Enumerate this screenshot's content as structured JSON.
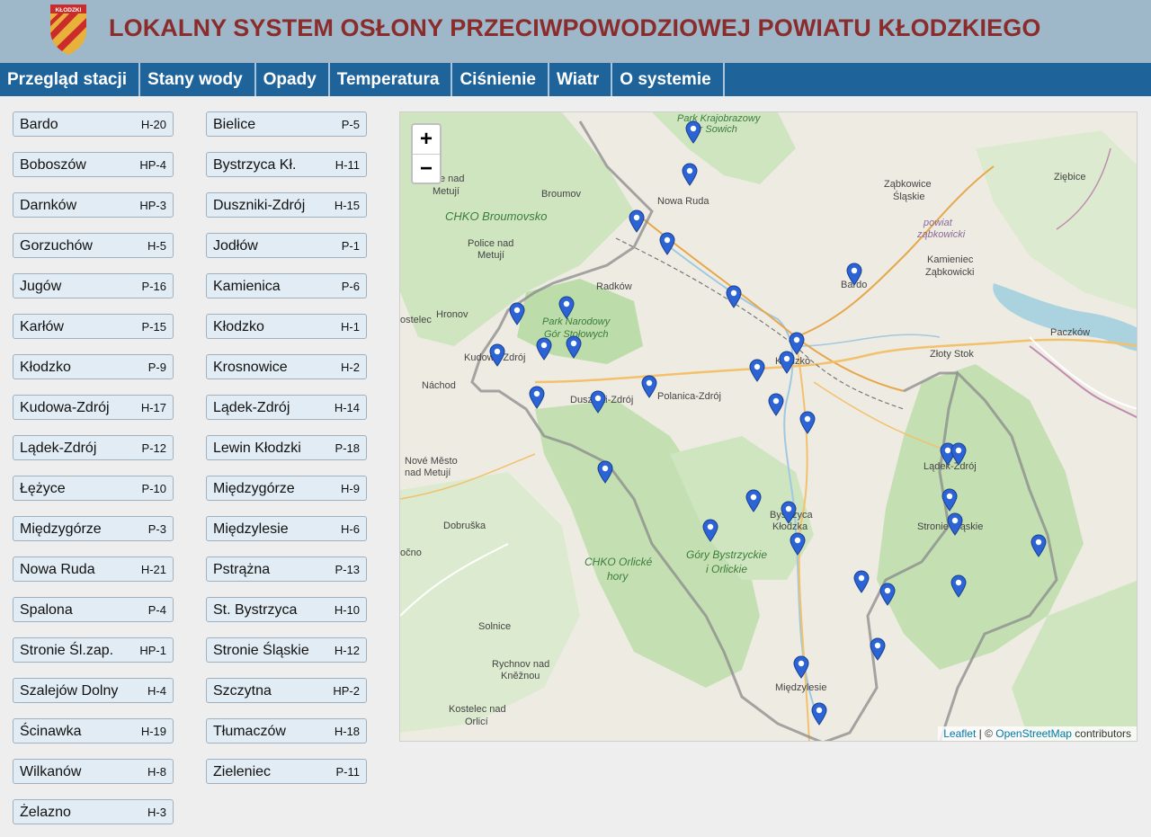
{
  "header": {
    "title": "LOKALNY SYSTEM OSŁONY PRZECIWPOWODZIOWEJ POWIATU KŁODZKIEGO",
    "logo_text": "KŁODZKI"
  },
  "nav": [
    "Przegląd stacji",
    "Stany wody",
    "Opady",
    "Temperatura",
    "Ciśnienie",
    "Wiatr",
    "O systemie"
  ],
  "stations_left": [
    {
      "name": "Bardo",
      "code": "H-20"
    },
    {
      "name": "Boboszów",
      "code": "HP-4"
    },
    {
      "name": "Darnków",
      "code": "HP-3"
    },
    {
      "name": "Gorzuchów",
      "code": "H-5"
    },
    {
      "name": "Jugów",
      "code": "P-16"
    },
    {
      "name": "Karłów",
      "code": "P-15"
    },
    {
      "name": "Kłodzko",
      "code": "P-9"
    },
    {
      "name": "Kudowa-Zdrój",
      "code": "H-17"
    },
    {
      "name": "Lądek-Zdrój",
      "code": "P-12"
    },
    {
      "name": "Łężyce",
      "code": "P-10"
    },
    {
      "name": "Międzygórze",
      "code": "P-3"
    },
    {
      "name": "Nowa Ruda",
      "code": "H-21"
    },
    {
      "name": "Spalona",
      "code": "P-4"
    },
    {
      "name": "Stronie Śl.zap.",
      "code": "HP-1"
    },
    {
      "name": "Szalejów Dolny",
      "code": "H-4"
    },
    {
      "name": "Ścinawka",
      "code": "H-19"
    },
    {
      "name": "Wilkanów",
      "code": "H-8"
    },
    {
      "name": "Żelazno",
      "code": "H-3"
    }
  ],
  "stations_right": [
    {
      "name": "Bielice",
      "code": "P-5"
    },
    {
      "name": "Bystrzyca Kł.",
      "code": "H-11"
    },
    {
      "name": "Duszniki-Zdrój",
      "code": "H-15"
    },
    {
      "name": "Jodłów",
      "code": "P-1"
    },
    {
      "name": "Kamienica",
      "code": "P-6"
    },
    {
      "name": "Kłodzko",
      "code": "H-1"
    },
    {
      "name": "Krosnowice",
      "code": "H-2"
    },
    {
      "name": "Lądek-Zdrój",
      "code": "H-14"
    },
    {
      "name": "Lewin Kłodzki",
      "code": "P-18"
    },
    {
      "name": "Międzygórze",
      "code": "H-9"
    },
    {
      "name": "Międzylesie",
      "code": "H-6"
    },
    {
      "name": "Pstrążna",
      "code": "P-13"
    },
    {
      "name": "St. Bystrzyca",
      "code": "H-10"
    },
    {
      "name": "Stronie Śląskie",
      "code": "H-12"
    },
    {
      "name": "Szczytna",
      "code": "HP-2"
    },
    {
      "name": "Tłumaczów",
      "code": "H-18"
    },
    {
      "name": "Zieleniec",
      "code": "P-11"
    }
  ],
  "map": {
    "zoom_in": "+",
    "zoom_out": "−",
    "attribution_leaflet": "Leaflet",
    "attribution_sep": " | © ",
    "attribution_osm": "OpenStreetMap",
    "attribution_tail": " contributors",
    "labels": {
      "park_sowie_1": "Park Krajobrazowy",
      "park_sowie_2": "Gór Sowich",
      "metuji_1": "ice nad",
      "metuji_2": "Metují",
      "broumov": "Broumov",
      "nowa_ruda": "Nowa Ruda",
      "chko_broumovsko": "CHKO Broumovsko",
      "police_1": "Police nad",
      "police_2": "Metují",
      "radkow": "Radków",
      "zabkowice_1": "Ząbkowice",
      "zabkowice_2": "Śląskie",
      "powiat_1": "powiat",
      "powiat_2": "ząbkowicki",
      "ziebice": "Ziębice",
      "kamieniec_1": "Kamieniec",
      "kamieniec_2": "Ząbkowicki",
      "bardo": "Bardo",
      "paczkow": "Paczków",
      "hronov": "Hronov",
      "kostelec": "ostelec",
      "park_narodowy_1": "Park Narodowy",
      "park_narodowy_2": "Gór Stołowych",
      "kudowa": "Kudowa-Zdrój",
      "klodzko": "Kłodzko",
      "zloty_stok": "Złoty Stok",
      "nachod": "Náchod",
      "duszniki": "Duszniki-Zdrój",
      "polanica": "Polanica-Zdrój",
      "nove_mesto_1": "Nové Město",
      "nove_mesto_2": "nad Metují",
      "ladek": "Lądek-Zdrój",
      "bystrzyca_1": "Bystrzyca",
      "bystrzyca_2": "Kłodzka",
      "dobruska": "Dobruška",
      "stronie": "Stronie Śląskie",
      "ocno": "očno",
      "chko_orlicke_1": "CHKO Orlické",
      "chko_orlicke_2": "hory",
      "gory_bystrzyckie_1": "Góry Bystrzyckie",
      "gory_bystrzyckie_2": "i Orlickie",
      "solnice": "Solnice",
      "rychnov_1": "Rychnov nad",
      "rychnov_2": "Kněžnou",
      "miedzylesie": "Międzylesie",
      "kostelec_orl_1": "Kostelec nad",
      "kostelec_orl_2": "Orlicí"
    }
  },
  "colors": {
    "header_bg": "#9eb8c9",
    "title": "#8a2c2c",
    "nav_bg": "#1f639b",
    "button_bg": "#e1ecf4",
    "marker": "#2c64d6"
  }
}
